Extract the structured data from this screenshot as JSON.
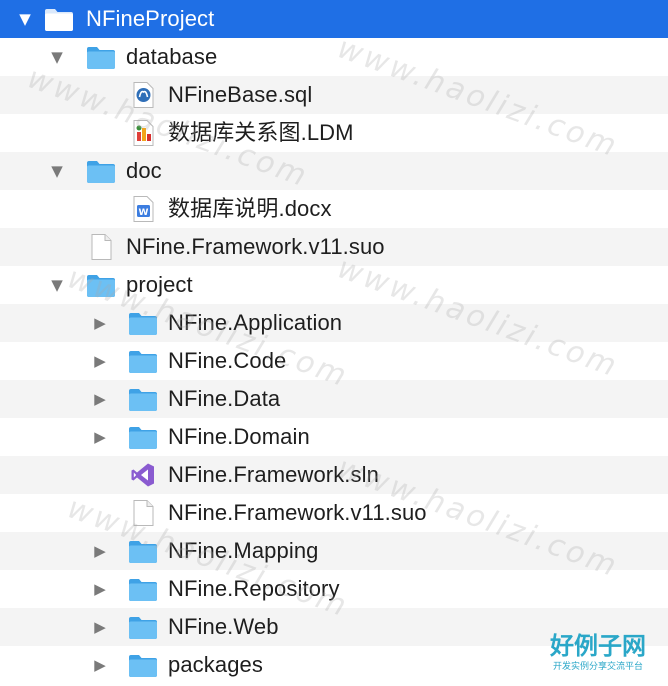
{
  "tree": {
    "root": "NFineProject",
    "database": {
      "folder": "database",
      "files": [
        "NFineBase.sql",
        "数据库关系图.LDM"
      ]
    },
    "doc": {
      "folder": "doc",
      "files": [
        "数据库说明.docx"
      ]
    },
    "suo_top": "NFine.Framework.v11.suo",
    "project": {
      "folder": "project",
      "items": [
        "NFine.Application",
        "NFine.Code",
        "NFine.Data",
        "NFine.Domain",
        "NFine.Framework.sln",
        "NFine.Framework.v11.suo",
        "NFine.Mapping",
        "NFine.Repository",
        "NFine.Web",
        "packages"
      ]
    }
  },
  "watermark": "www.haolizi.com",
  "brand": {
    "title": "好例子网",
    "subtitle": "开发实例分享交流平台"
  },
  "colors": {
    "selection": "#1f6fe5",
    "folder": "#5ab4f0",
    "row_alt": "#f4f4f4"
  },
  "icons": {
    "folder": "folder-icon",
    "sql": "sql-file-icon",
    "ldm": "ldm-file-icon",
    "docx": "word-doc-icon",
    "suo": "blank-file-icon",
    "sln": "visual-studio-icon"
  }
}
